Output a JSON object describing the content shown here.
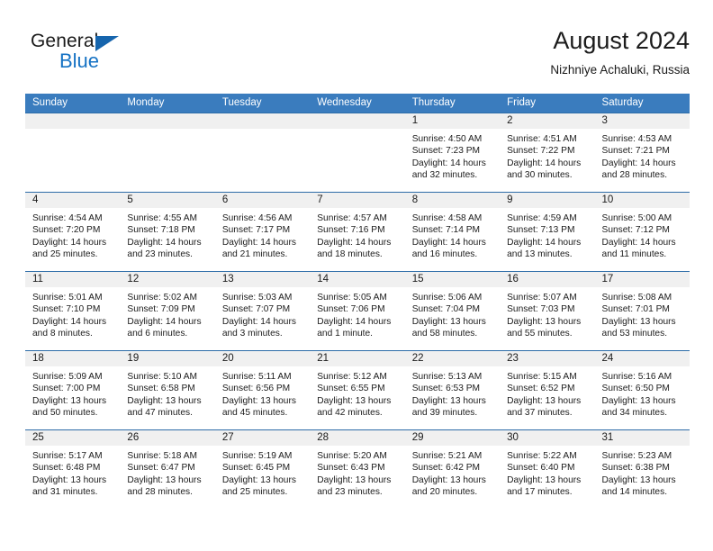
{
  "logo": {
    "word_one": "General",
    "word_two": "Blue",
    "triangle_icon": "triangle-icon",
    "accent_color": "#1572c4",
    "triangle_color": "#1665ad"
  },
  "header": {
    "title": "August 2024",
    "subtitle": "Nizhniye Achaluki, Russia"
  },
  "colors": {
    "header_row_bg": "#3a7cbe",
    "week_border": "#2d6ca8",
    "day_number_bg": "#f0f0f0",
    "text": "#1b1b1b"
  },
  "weekdays": [
    "Sunday",
    "Monday",
    "Tuesday",
    "Wednesday",
    "Thursday",
    "Friday",
    "Saturday"
  ],
  "labels": {
    "sunrise": "Sunrise:",
    "sunset": "Sunset:",
    "daylight": "Daylight:"
  },
  "weeks": [
    [
      {
        "day": "",
        "sunrise": "",
        "sunset": "",
        "daylight_1": "",
        "daylight_2": "",
        "empty": true
      },
      {
        "day": "",
        "sunrise": "",
        "sunset": "",
        "daylight_1": "",
        "daylight_2": "",
        "empty": true
      },
      {
        "day": "",
        "sunrise": "",
        "sunset": "",
        "daylight_1": "",
        "daylight_2": "",
        "empty": true
      },
      {
        "day": "",
        "sunrise": "",
        "sunset": "",
        "daylight_1": "",
        "daylight_2": "",
        "empty": true
      },
      {
        "day": "1",
        "sunrise": "Sunrise: 4:50 AM",
        "sunset": "Sunset: 7:23 PM",
        "daylight_1": "Daylight: 14 hours",
        "daylight_2": "and 32 minutes."
      },
      {
        "day": "2",
        "sunrise": "Sunrise: 4:51 AM",
        "sunset": "Sunset: 7:22 PM",
        "daylight_1": "Daylight: 14 hours",
        "daylight_2": "and 30 minutes."
      },
      {
        "day": "3",
        "sunrise": "Sunrise: 4:53 AM",
        "sunset": "Sunset: 7:21 PM",
        "daylight_1": "Daylight: 14 hours",
        "daylight_2": "and 28 minutes."
      }
    ],
    [
      {
        "day": "4",
        "sunrise": "Sunrise: 4:54 AM",
        "sunset": "Sunset: 7:20 PM",
        "daylight_1": "Daylight: 14 hours",
        "daylight_2": "and 25 minutes."
      },
      {
        "day": "5",
        "sunrise": "Sunrise: 4:55 AM",
        "sunset": "Sunset: 7:18 PM",
        "daylight_1": "Daylight: 14 hours",
        "daylight_2": "and 23 minutes."
      },
      {
        "day": "6",
        "sunrise": "Sunrise: 4:56 AM",
        "sunset": "Sunset: 7:17 PM",
        "daylight_1": "Daylight: 14 hours",
        "daylight_2": "and 21 minutes."
      },
      {
        "day": "7",
        "sunrise": "Sunrise: 4:57 AM",
        "sunset": "Sunset: 7:16 PM",
        "daylight_1": "Daylight: 14 hours",
        "daylight_2": "and 18 minutes."
      },
      {
        "day": "8",
        "sunrise": "Sunrise: 4:58 AM",
        "sunset": "Sunset: 7:14 PM",
        "daylight_1": "Daylight: 14 hours",
        "daylight_2": "and 16 minutes."
      },
      {
        "day": "9",
        "sunrise": "Sunrise: 4:59 AM",
        "sunset": "Sunset: 7:13 PM",
        "daylight_1": "Daylight: 14 hours",
        "daylight_2": "and 13 minutes."
      },
      {
        "day": "10",
        "sunrise": "Sunrise: 5:00 AM",
        "sunset": "Sunset: 7:12 PM",
        "daylight_1": "Daylight: 14 hours",
        "daylight_2": "and 11 minutes."
      }
    ],
    [
      {
        "day": "11",
        "sunrise": "Sunrise: 5:01 AM",
        "sunset": "Sunset: 7:10 PM",
        "daylight_1": "Daylight: 14 hours",
        "daylight_2": "and 8 minutes."
      },
      {
        "day": "12",
        "sunrise": "Sunrise: 5:02 AM",
        "sunset": "Sunset: 7:09 PM",
        "daylight_1": "Daylight: 14 hours",
        "daylight_2": "and 6 minutes."
      },
      {
        "day": "13",
        "sunrise": "Sunrise: 5:03 AM",
        "sunset": "Sunset: 7:07 PM",
        "daylight_1": "Daylight: 14 hours",
        "daylight_2": "and 3 minutes."
      },
      {
        "day": "14",
        "sunrise": "Sunrise: 5:05 AM",
        "sunset": "Sunset: 7:06 PM",
        "daylight_1": "Daylight: 14 hours",
        "daylight_2": "and 1 minute."
      },
      {
        "day": "15",
        "sunrise": "Sunrise: 5:06 AM",
        "sunset": "Sunset: 7:04 PM",
        "daylight_1": "Daylight: 13 hours",
        "daylight_2": "and 58 minutes."
      },
      {
        "day": "16",
        "sunrise": "Sunrise: 5:07 AM",
        "sunset": "Sunset: 7:03 PM",
        "daylight_1": "Daylight: 13 hours",
        "daylight_2": "and 55 minutes."
      },
      {
        "day": "17",
        "sunrise": "Sunrise: 5:08 AM",
        "sunset": "Sunset: 7:01 PM",
        "daylight_1": "Daylight: 13 hours",
        "daylight_2": "and 53 minutes."
      }
    ],
    [
      {
        "day": "18",
        "sunrise": "Sunrise: 5:09 AM",
        "sunset": "Sunset: 7:00 PM",
        "daylight_1": "Daylight: 13 hours",
        "daylight_2": "and 50 minutes."
      },
      {
        "day": "19",
        "sunrise": "Sunrise: 5:10 AM",
        "sunset": "Sunset: 6:58 PM",
        "daylight_1": "Daylight: 13 hours",
        "daylight_2": "and 47 minutes."
      },
      {
        "day": "20",
        "sunrise": "Sunrise: 5:11 AM",
        "sunset": "Sunset: 6:56 PM",
        "daylight_1": "Daylight: 13 hours",
        "daylight_2": "and 45 minutes."
      },
      {
        "day": "21",
        "sunrise": "Sunrise: 5:12 AM",
        "sunset": "Sunset: 6:55 PM",
        "daylight_1": "Daylight: 13 hours",
        "daylight_2": "and 42 minutes."
      },
      {
        "day": "22",
        "sunrise": "Sunrise: 5:13 AM",
        "sunset": "Sunset: 6:53 PM",
        "daylight_1": "Daylight: 13 hours",
        "daylight_2": "and 39 minutes."
      },
      {
        "day": "23",
        "sunrise": "Sunrise: 5:15 AM",
        "sunset": "Sunset: 6:52 PM",
        "daylight_1": "Daylight: 13 hours",
        "daylight_2": "and 37 minutes."
      },
      {
        "day": "24",
        "sunrise": "Sunrise: 5:16 AM",
        "sunset": "Sunset: 6:50 PM",
        "daylight_1": "Daylight: 13 hours",
        "daylight_2": "and 34 minutes."
      }
    ],
    [
      {
        "day": "25",
        "sunrise": "Sunrise: 5:17 AM",
        "sunset": "Sunset: 6:48 PM",
        "daylight_1": "Daylight: 13 hours",
        "daylight_2": "and 31 minutes."
      },
      {
        "day": "26",
        "sunrise": "Sunrise: 5:18 AM",
        "sunset": "Sunset: 6:47 PM",
        "daylight_1": "Daylight: 13 hours",
        "daylight_2": "and 28 minutes."
      },
      {
        "day": "27",
        "sunrise": "Sunrise: 5:19 AM",
        "sunset": "Sunset: 6:45 PM",
        "daylight_1": "Daylight: 13 hours",
        "daylight_2": "and 25 minutes."
      },
      {
        "day": "28",
        "sunrise": "Sunrise: 5:20 AM",
        "sunset": "Sunset: 6:43 PM",
        "daylight_1": "Daylight: 13 hours",
        "daylight_2": "and 23 minutes."
      },
      {
        "day": "29",
        "sunrise": "Sunrise: 5:21 AM",
        "sunset": "Sunset: 6:42 PM",
        "daylight_1": "Daylight: 13 hours",
        "daylight_2": "and 20 minutes."
      },
      {
        "day": "30",
        "sunrise": "Sunrise: 5:22 AM",
        "sunset": "Sunset: 6:40 PM",
        "daylight_1": "Daylight: 13 hours",
        "daylight_2": "and 17 minutes."
      },
      {
        "day": "31",
        "sunrise": "Sunrise: 5:23 AM",
        "sunset": "Sunset: 6:38 PM",
        "daylight_1": "Daylight: 13 hours",
        "daylight_2": "and 14 minutes."
      }
    ]
  ]
}
